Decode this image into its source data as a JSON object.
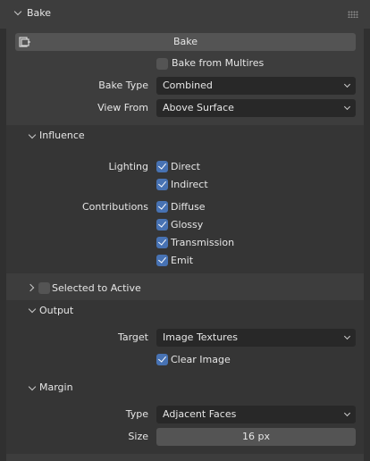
{
  "bake_panel": {
    "title": "Bake"
  },
  "bake_button": {
    "label": "Bake"
  },
  "bake_from_multires": {
    "label": "Bake from Multires",
    "checked": false
  },
  "bake_type": {
    "label": "Bake Type",
    "value": "Combined"
  },
  "view_from": {
    "label": "View From",
    "value": "Above Surface"
  },
  "influence": {
    "title": "Influence",
    "lighting_label": "Lighting",
    "direct": {
      "label": "Direct",
      "checked": true
    },
    "indirect": {
      "label": "Indirect",
      "checked": true
    },
    "contributions_label": "Contributions",
    "diffuse": {
      "label": "Diffuse",
      "checked": true
    },
    "glossy": {
      "label": "Glossy",
      "checked": true
    },
    "transmission": {
      "label": "Transmission",
      "checked": true
    },
    "emit": {
      "label": "Emit",
      "checked": true
    }
  },
  "selected_to_active": {
    "label": "Selected to Active",
    "checked": false
  },
  "output": {
    "title": "Output",
    "target_label": "Target",
    "target_value": "Image Textures",
    "clear_image": {
      "label": "Clear Image",
      "checked": true
    }
  },
  "margin": {
    "title": "Margin",
    "type_label": "Type",
    "type_value": "Adjacent Faces",
    "size_label": "Size",
    "size_value": "16 px"
  },
  "colors": {
    "panel_bg": "#3d3d3d",
    "subpanel_bg": "#353535",
    "window_bg": "#303030",
    "button_bg": "#545454",
    "dropdown_bg": "#282828",
    "checkbox_accent": "#4772b3",
    "text": "#e6e6e6"
  }
}
